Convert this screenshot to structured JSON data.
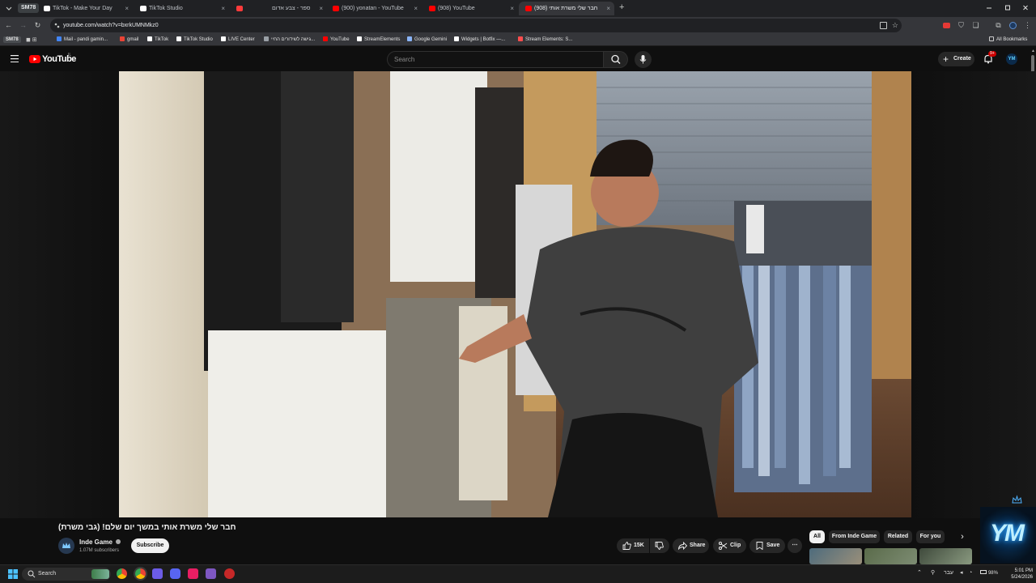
{
  "browser": {
    "profile_chip": "SM78",
    "tabs": [
      {
        "title": "TikTok - Make Your Day",
        "favicon_color": "#ffffff"
      },
      {
        "title": "TikTok Studio",
        "favicon_color": "#ffffff"
      },
      {
        "title": "",
        "favicon_color": "#ff3b3b"
      },
      {
        "title": "ספר - צבע אדום",
        "favicon_color": "#ff0000"
      },
      {
        "title": "(900) yonatan - YouTube",
        "favicon_color": "#ff0000"
      },
      {
        "title": "(908) YouTube",
        "favicon_color": "#ff0000"
      },
      {
        "title": "חבר שלי משרת אותי (908)",
        "favicon_color": "#ff0000"
      }
    ],
    "new_tab_label": "+",
    "close_label": "×",
    "url": "youtube.com/watch?v=bxrkUMNMkz0",
    "bookmarks": [
      {
        "label": "SM78",
        "color": "#9aa0a6"
      },
      {
        "label": "Mail - pandi gamin...",
        "color": "#4285f4"
      },
      {
        "label": "gmail",
        "color": "#ea4335"
      },
      {
        "label": "TikTok",
        "color": "#ffffff"
      },
      {
        "label": "TikTok Studio",
        "color": "#ffffff"
      },
      {
        "label": "LIVE Center",
        "color": "#ffffff"
      },
      {
        "label": "גישה לשידורים החיי...",
        "color": "#9aa0a6"
      },
      {
        "label": "YouTube",
        "color": "#ff0000"
      },
      {
        "label": "StreamElements",
        "color": "#ffffff"
      },
      {
        "label": "Google Gemini",
        "color": "#8ab4f8"
      },
      {
        "label": "Widgets | Botfix —...",
        "color": "#ffffff"
      },
      {
        "label": "Stream Elements: S...",
        "color": "#ff4d4d"
      }
    ],
    "all_bookmarks": "All Bookmarks"
  },
  "youtube": {
    "logo_text": "YouTube",
    "logo_region": "IL",
    "search_placeholder": "Search",
    "create_label": "Create",
    "notif_badge": "9+",
    "avatar_text": "YM"
  },
  "video": {
    "title": "חבר שלי משרת אותי במשך יום שלם! (גבי משרת)",
    "channel": "Inde Game",
    "subscribers": "1.07M subscribers",
    "subscribe_label": "Subscribe",
    "likes": "15K",
    "share_label": "Share",
    "clip_label": "Clip",
    "save_label": "Save",
    "more_label": "⋯"
  },
  "chips": [
    {
      "label": "All",
      "active": true
    },
    {
      "label": "From Inde Game",
      "active": false
    },
    {
      "label": "Related",
      "active": false
    },
    {
      "label": "For you",
      "active": false
    }
  ],
  "overlay_logo": "YM",
  "taskbar": {
    "search_placeholder": "Search",
    "lang": "עבר",
    "battery": "98%",
    "time": "5:01 PM",
    "date": "5/24/2026"
  }
}
